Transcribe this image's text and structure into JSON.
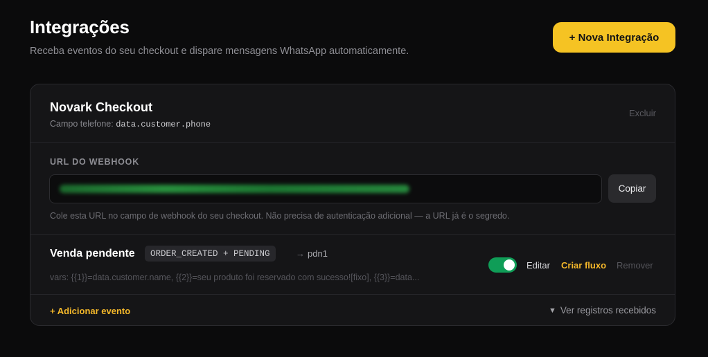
{
  "header": {
    "title": "Integrações",
    "subtitle": "Receba eventos do seu checkout e dispare mensagens WhatsApp automaticamente.",
    "new_button_label": "+ Nova Integração"
  },
  "integration": {
    "name": "Novark Checkout",
    "phone_field_label": "Campo telefone:",
    "phone_field_value": "data.customer.phone",
    "delete_label": "Excluir",
    "webhook": {
      "label": "URL DO WEBHOOK",
      "copy_label": "Copiar",
      "hint": "Cole esta URL no campo de webhook do seu checkout. Não precisa de autenticação adicional — a URL já é o segredo."
    },
    "events": [
      {
        "title": "Venda pendente",
        "badge": "ORDER_CREATED + PENDING",
        "target": "pdn1",
        "vars": "vars: {{1}}=data.customer.name, {{2}}=seu produto foi reservado com sucesso![fixo], {{3}}=data...",
        "enabled": true,
        "edit_label": "Editar",
        "flow_label": "Criar fluxo",
        "remove_label": "Remover"
      }
    ],
    "add_event_label": "+ Adicionar evento",
    "logs_label": "Ver registros recebidos"
  },
  "colors": {
    "accent": "#f5c323",
    "toggle_on": "#0f9d57",
    "link_accent": "#f5b82a"
  }
}
